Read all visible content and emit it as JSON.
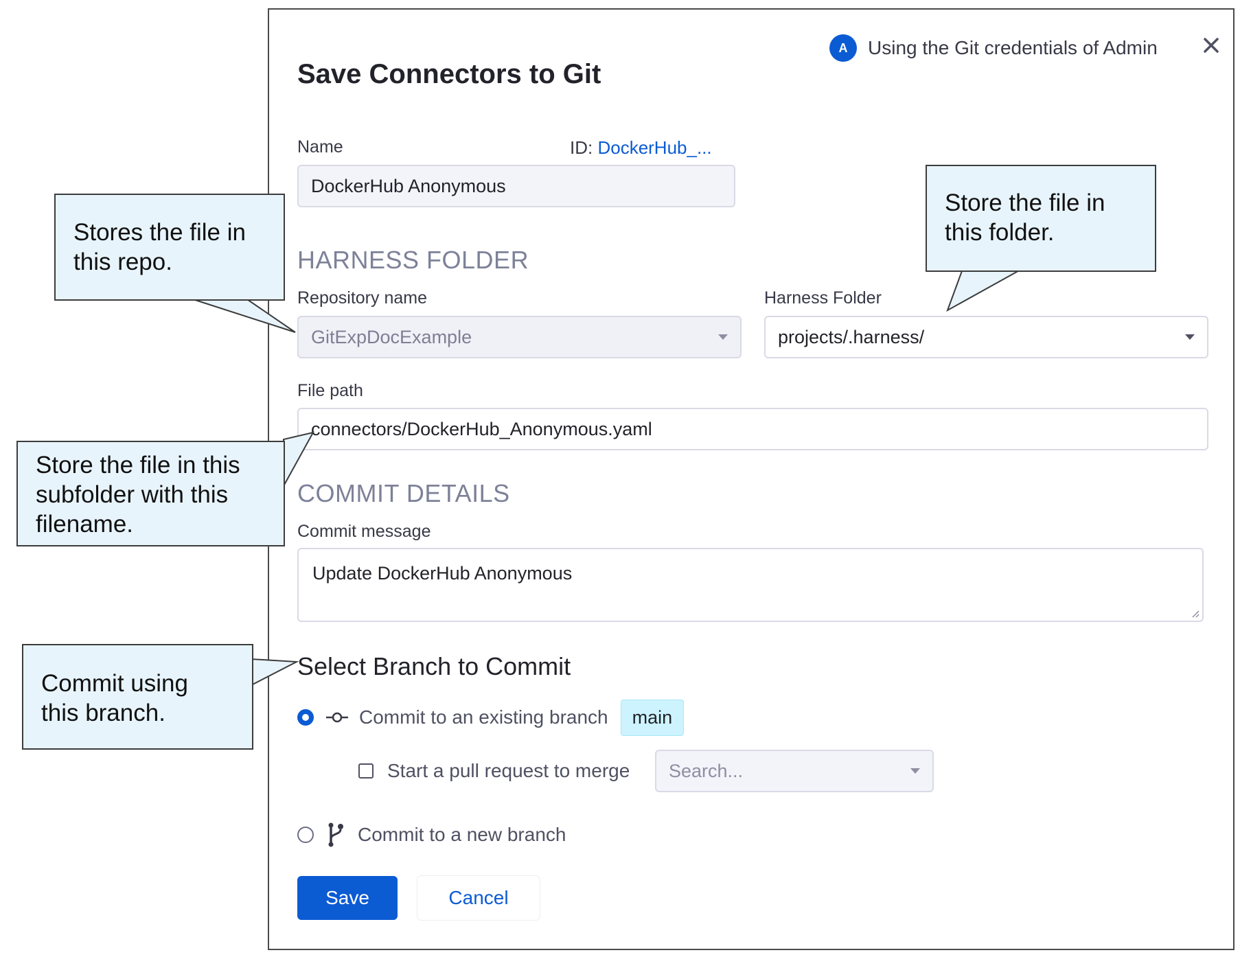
{
  "dialog": {
    "title": "Save Connectors to Git",
    "credentials": {
      "avatar_letter": "A",
      "text": "Using the Git credentials of Admin"
    },
    "close_icon": "close-icon"
  },
  "name_field": {
    "label": "Name",
    "id_label": "ID: ",
    "id_value": "DockerHub_...",
    "value": "DockerHub Anonymous"
  },
  "harness_section": {
    "heading": "HARNESS FOLDER",
    "repo_label": "Repository name",
    "repo_value": "GitExpDocExample",
    "folder_label": "Harness Folder",
    "folder_value": "projects/.harness/",
    "file_path_label": "File path",
    "file_path_value": "connectors/DockerHub_Anonymous.yaml"
  },
  "commit_section": {
    "heading": "COMMIT DETAILS",
    "message_label": "Commit message",
    "message_value": "Update DockerHub Anonymous"
  },
  "branch_section": {
    "title": "Select Branch to Commit",
    "existing_option": "Commit to an existing branch",
    "existing_branch": "main",
    "existing_selected": true,
    "pr_label": "Start a pull request to merge",
    "pr_placeholder": "Search...",
    "new_option": "Commit to a new branch"
  },
  "buttons": {
    "save": "Save",
    "cancel": "Cancel"
  },
  "callouts": {
    "repo": [
      "Stores the file in",
      "this repo."
    ],
    "folder": [
      "Store the file in",
      "this folder."
    ],
    "file": [
      "Store the file in this",
      "subfolder with this",
      "filename."
    ],
    "branch": [
      "Commit using",
      "this branch."
    ]
  },
  "colors": {
    "accent": "#0b5bd3",
    "callout_bg": "#e8f4fb",
    "branch_chip": "#cdf4fe"
  }
}
